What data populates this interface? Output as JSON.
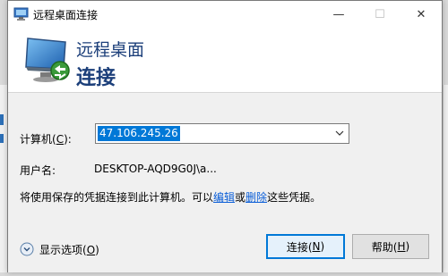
{
  "window": {
    "title": "远程桌面连接"
  },
  "titlebar": {
    "minimize_symbol": "—",
    "maximize_symbol": "☐",
    "close_symbol": "✕"
  },
  "header": {
    "line1": "远程桌面",
    "line2": "连接"
  },
  "form": {
    "computer_label_prefix": "计算机(",
    "computer_label_accel": "C",
    "computer_label_suffix": "):",
    "computer_value": "47.106.245.26",
    "username_label": "用户名:",
    "username_value": "DESKTOP-AQD9G0J\\a...",
    "info_prefix": "将使用保存的凭据连接到此计算机。可以",
    "info_link_edit": "编辑",
    "info_or": "或",
    "info_link_delete": "删除",
    "info_suffix": "这些凭据。"
  },
  "footer": {
    "show_options_prefix": "显示选项(",
    "show_options_accel": "O",
    "show_options_suffix": ")",
    "connect_prefix": "连接(",
    "connect_accel": "N",
    "connect_suffix": ")",
    "help_prefix": "帮助(",
    "help_accel": "H",
    "help_suffix": ")"
  },
  "colors": {
    "accent": "#0078d7",
    "header_text": "#1c3f7a",
    "link": "#0b5ed7",
    "body_bg": "#f0f0f0"
  },
  "icons": {
    "title": "remote-desktop-icon",
    "header": "remote-desktop-monitor-icon",
    "combo_arrow": "chevron-down-icon",
    "options": "expand-options-icon"
  }
}
